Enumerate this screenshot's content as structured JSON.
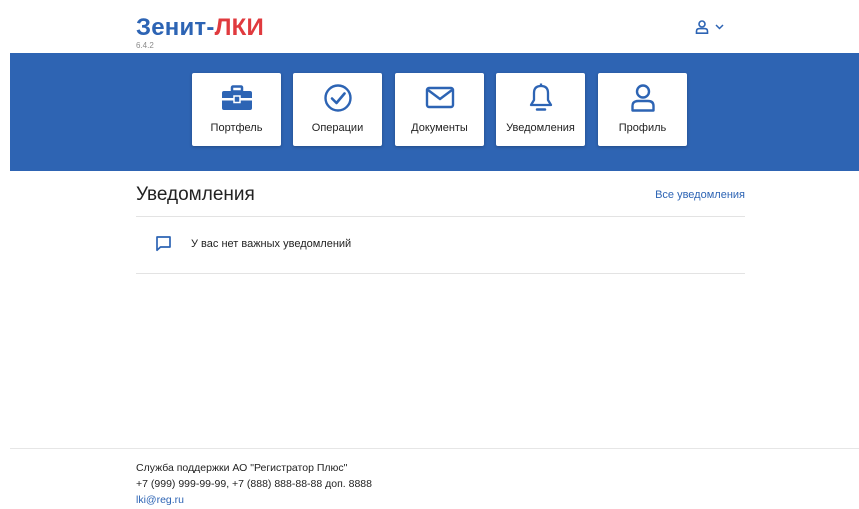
{
  "header": {
    "logo_brand": "Зенит-",
    "logo_product": "ЛКИ",
    "version": "6.4.2"
  },
  "nav": {
    "tiles": [
      {
        "label": "Портфель",
        "icon": "briefcase-icon"
      },
      {
        "label": "Операции",
        "icon": "check-circle-icon"
      },
      {
        "label": "Документы",
        "icon": "envelope-icon"
      },
      {
        "label": "Уведомления",
        "icon": "bell-icon"
      },
      {
        "label": "Профиль",
        "icon": "user-icon"
      }
    ]
  },
  "notifications": {
    "title": "Уведомления",
    "all_link": "Все уведомления",
    "empty_message": "У вас нет важных уведомлений"
  },
  "footer": {
    "support": "Служба поддержки АО \"Регистратор Плюс\"",
    "phones": "+7 (999) 999-99-99, +7 (888) 888-88-88 доп. 8888",
    "email": "lki@reg.ru"
  },
  "colors": {
    "brand_blue": "#2e64b3",
    "brand_red": "#e03a3e",
    "link_blue": "#2d64b4"
  }
}
